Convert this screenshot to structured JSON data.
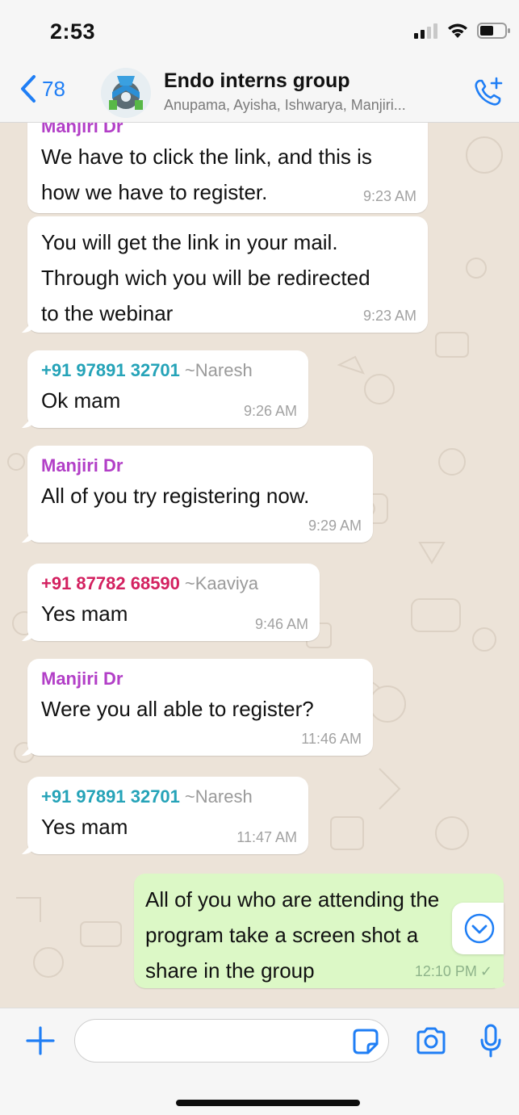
{
  "status_bar": {
    "time": "2:53"
  },
  "header": {
    "back_count": "78",
    "title": "Endo interns group",
    "members": "Anupama, Ayisha, Ishwarya, Manjiri..."
  },
  "messages": [
    {
      "sender": "Manjiri Dr",
      "lines": [
        "We have to click the link, and this is",
        "how we have to register."
      ],
      "time": "9:23 AM"
    },
    {
      "lines": [
        "You will get the link in your mail.",
        "Through wich you will be redirected",
        "to the webinar"
      ],
      "time": "9:23 AM"
    },
    {
      "sender": "+91 97891 32701",
      "alias": "~Naresh",
      "lines": [
        "Ok mam"
      ],
      "time": "9:26 AM"
    },
    {
      "sender": "Manjiri Dr",
      "lines": [
        "All of you try registering now."
      ],
      "time": "9:29 AM"
    },
    {
      "sender": "+91 87782 68590",
      "alias": "~Kaaviya",
      "lines": [
        "Yes mam"
      ],
      "time": "9:46 AM"
    },
    {
      "sender": "Manjiri Dr",
      "lines": [
        "Were you all able to register?"
      ],
      "time": "11:46 AM"
    },
    {
      "sender": "+91 97891 32701",
      "alias": "~Naresh",
      "lines": [
        "Yes mam"
      ],
      "time": "11:47 AM"
    },
    {
      "lines": [
        "All of you who are attending the",
        "program  take a screen shot a",
        "share in the group"
      ],
      "time": "12:10 PM",
      "status": "✓"
    }
  ],
  "input": {
    "value": "",
    "placeholder": ""
  },
  "colors": {
    "accent_blue": "#1f7ef5",
    "sender_manjiri": "#b23fc7",
    "sender_naresh": "#25a3b8",
    "sender_kaaviya": "#d32160",
    "outgoing_bubble": "#dcf8c6",
    "incoming_bubble": "#ffffff",
    "chat_background": "#ece3d8"
  },
  "icons": {
    "back": "chevron-left-icon",
    "call": "add-call-icon",
    "plus": "plus-icon",
    "sticker": "sticker-icon",
    "camera": "camera-icon",
    "mic": "microphone-icon",
    "scroll": "chevron-down-icon"
  }
}
